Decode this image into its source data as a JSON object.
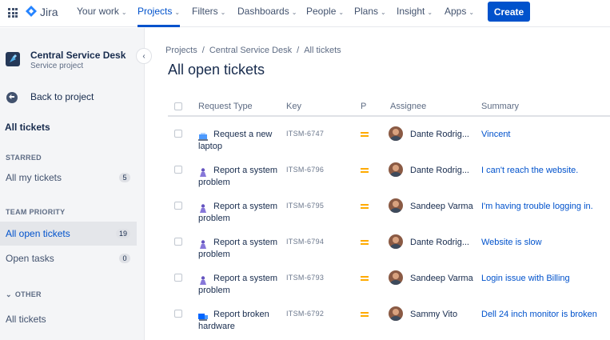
{
  "topnav": {
    "logo_text": "Jira",
    "items": [
      {
        "label": "Your work",
        "chevron": "⌄"
      },
      {
        "label": "Projects",
        "chevron": "⌄"
      },
      {
        "label": "Filters",
        "chevron": "⌄"
      },
      {
        "label": "Dashboards",
        "chevron": "⌄"
      },
      {
        "label": "People",
        "chevron": "⌄"
      },
      {
        "label": "Plans",
        "chevron": "⌄"
      },
      {
        "label": "Insight",
        "chevron": "⌄"
      },
      {
        "label": "Apps",
        "chevron": "⌄"
      }
    ],
    "create_label": "Create",
    "accent": "#0052cc"
  },
  "sidebar": {
    "project_name": "Central Service Desk",
    "project_type": "Service project",
    "collapse_glyph": "‹",
    "back_label": "Back to project",
    "heading": "All tickets",
    "sections": {
      "starred": "STARRED",
      "team_priority": "TEAM PRIORITY",
      "other": "OTHER",
      "other_chevron": "⌄"
    },
    "items": {
      "all_my_tickets": {
        "label": "All my tickets",
        "count": "5"
      },
      "all_open_tickets": {
        "label": "All open tickets",
        "count": "19"
      },
      "open_tasks": {
        "label": "Open tasks",
        "count": "0"
      },
      "all_tickets": {
        "label": "All tickets"
      }
    }
  },
  "main": {
    "breadcrumb": [
      "Projects",
      "/",
      "Central Service Desk",
      "/",
      "All tickets"
    ],
    "title": "All open tickets",
    "columns": {
      "request_type": "Request Type",
      "key": "Key",
      "priority": "P",
      "assignee": "Assignee",
      "summary": "Summary"
    },
    "rows": [
      {
        "request_type": "Request a new laptop",
        "icon": "laptop-request-icon",
        "key": "ITSM-6747",
        "assignee": "Dante Rodrig...",
        "summary": "Vincent"
      },
      {
        "request_type": "Report a system problem",
        "icon": "person-report-icon",
        "key": "ITSM-6796",
        "assignee": "Dante Rodrig...",
        "summary": "I can't reach the website."
      },
      {
        "request_type": "Report a system problem",
        "icon": "person-report-icon",
        "key": "ITSM-6795",
        "assignee": "Sandeep Varma",
        "summary": "I'm having trouble logging in."
      },
      {
        "request_type": "Report a system problem",
        "icon": "person-report-icon",
        "key": "ITSM-6794",
        "assignee": "Dante Rodrig...",
        "summary": "Website is slow"
      },
      {
        "request_type": "Report a system problem",
        "icon": "person-report-icon",
        "key": "ITSM-6793",
        "assignee": "Sandeep Varma",
        "summary": "Login issue with Billing"
      },
      {
        "request_type": "Report broken hardware",
        "icon": "hardware-report-icon",
        "key": "ITSM-6792",
        "assignee": "Sammy Vito",
        "summary": "Dell 24 inch monitor is broken"
      }
    ],
    "priority_color": "#ffab00",
    "link_color": "#0052cc"
  }
}
